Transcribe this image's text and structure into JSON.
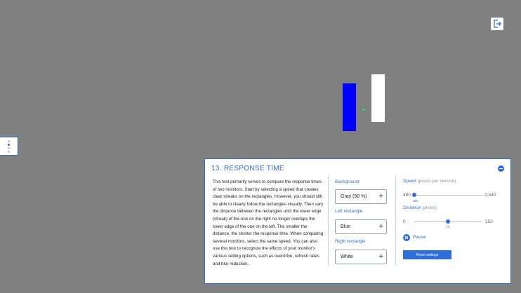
{
  "colors": {
    "background": "#808080",
    "accent": "#2f6ed8",
    "left_rectangle": "#0000ff",
    "right_rectangle": "#ffffff"
  },
  "icons": {
    "exit": "exit-icon",
    "collapse": "minus-circle-icon",
    "pause": "pause-icon"
  },
  "panel": {
    "title": "13. RESPONSE TIME",
    "description": "This test primarily serves to compare the response times of two monitors. Start by selecting a speed that creates clear streaks on the rectangles. However, you should still be able to clearly follow the rectangles visually. Then vary the distance between the rectangles until the lower edge (streak) of the one on the right no longer overlaps the lower edge of the one on the left. The smaller the distance, the shorter the response time. When comparing several monitors, select the same speed. You can also use this test to recognize the effects of your monitor's various setting options, such as overdrive, refresh rates and blur reduction."
  },
  "settings": {
    "background": {
      "label": "Background",
      "value": "Gray (50 %)"
    },
    "left_rectangle": {
      "label": "Left rectangle",
      "value": "Blue"
    },
    "right_rectangle": {
      "label": "Right rectangle",
      "value": "White"
    }
  },
  "speed": {
    "label": "Speed",
    "unit": "(pixels per second)",
    "min": "480",
    "max": "3,840",
    "value": "480",
    "fraction": 0.0
  },
  "distance": {
    "label": "Distance",
    "unit": "(pixels)",
    "min": "0",
    "max": "150",
    "value": "75",
    "fraction": 0.5
  },
  "controls": {
    "pause_label": "Pause",
    "reset_label": "Reset settings"
  }
}
